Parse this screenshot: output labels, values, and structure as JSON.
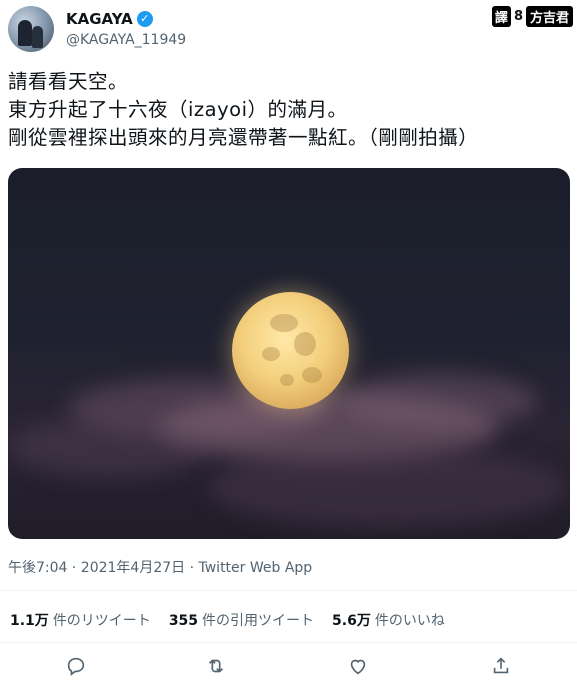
{
  "author": {
    "name": "KAGAYA",
    "handle": "@KAGAYA_11949",
    "verified_glyph": "✓"
  },
  "credit": {
    "mark": "譯",
    "separator": "8",
    "translator": "方吉君"
  },
  "tweet": {
    "lines": [
      "請看看天空。",
      "東方升起了十六夜（izayoi）的滿月。",
      "剛從雲裡探出頭來的月亮還帶著一點紅。（剛剛拍攝）"
    ],
    "image_icon": "full-moon-photo"
  },
  "meta": {
    "timestamp": "午後7:04 · 2021年4月27日 · Twitter Web App"
  },
  "stats": [
    {
      "count": "1.1万",
      "label": "件のリツイート"
    },
    {
      "count": "355",
      "label": "件の引用ツイート"
    },
    {
      "count": "5.6万",
      "label": "件のいいね"
    }
  ],
  "actions": [
    {
      "icon": "reply-icon"
    },
    {
      "icon": "retweet-icon"
    },
    {
      "icon": "like-icon"
    },
    {
      "icon": "share-icon"
    }
  ]
}
